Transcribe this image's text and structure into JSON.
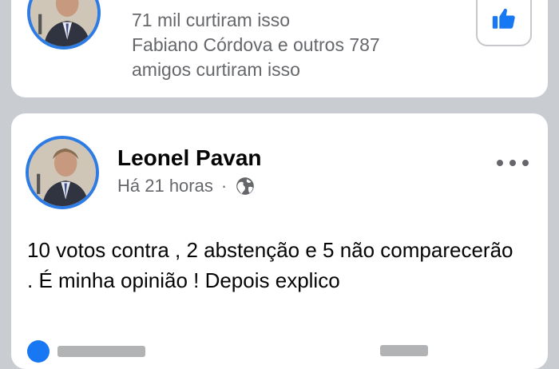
{
  "page_card": {
    "likes": "71 mil curtiram isso",
    "friends_line1": "Fabiano Córdova e outros 787",
    "friends_line2": "amigos curtiram isso"
  },
  "post": {
    "author": "Leonel Pavan",
    "time": "Há 21 horas",
    "separator": "·",
    "body": "10 votos contra , 2 abstenção e 5 não comparecerão . É minha opinião ! Depois explico"
  },
  "colors": {
    "accent": "#1877f2",
    "avatar_ring": "#2d7be5",
    "secondary_text": "#65676b",
    "background": "#c9ccd1"
  },
  "icons": {
    "like_button": "thumbs-up-icon",
    "privacy": "globe-icon",
    "more": "more-options-icon"
  }
}
